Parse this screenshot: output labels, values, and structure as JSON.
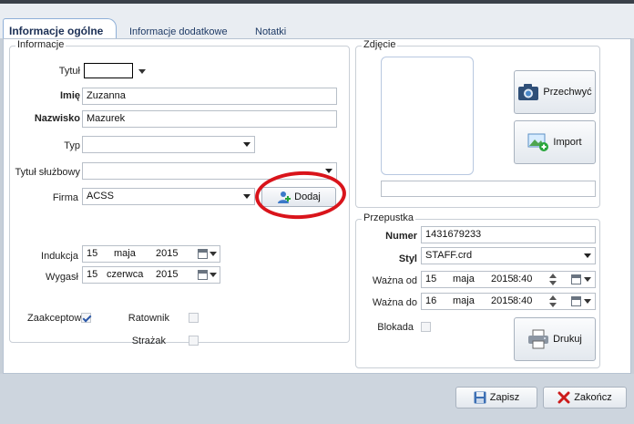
{
  "tabs": [
    "Informacje ogólne",
    "Informacje dodatkowe",
    "Notatki"
  ],
  "info": {
    "title": "Informacje",
    "fields": {
      "tytul_label": "Tytuł",
      "tytul_value": "",
      "imie_label": "Imię",
      "imie_value": "Zuzanna",
      "nazwisko_label": "Nazwisko",
      "nazwisko_value": "Mazurek",
      "typ_label": "Typ",
      "typ_value": "",
      "tytul_sluzbowy_label": "Tytuł służbowy",
      "tytul_sluzbowy_value": "",
      "firma_label": "Firma",
      "firma_value": "ACSS",
      "dodaj_label": "Dodaj"
    },
    "indukcja": {
      "label": "Indukcja",
      "day": "15",
      "month": "maja",
      "year": "2015"
    },
    "wygasl": {
      "label": "Wygasł",
      "day": "15",
      "month": "czerwca",
      "year": "2015"
    },
    "checks": {
      "zaakceptow": {
        "label": "Zaakceptow",
        "checked": true
      },
      "ratownik": {
        "label": "Ratownik",
        "checked": false
      },
      "strazak": {
        "label": "Strażak",
        "checked": false
      }
    }
  },
  "photo": {
    "title": "Zdjęcie",
    "capture_label": "Przechwyć",
    "import_label": "Import",
    "caption": ""
  },
  "pass": {
    "title": "Przepustka",
    "numer_label": "Numer",
    "numer_value": "1431679233",
    "styl_label": "Styl",
    "styl_value": "STAFF.crd",
    "wazna_od": {
      "label": "Ważna od",
      "day": "15",
      "month": "maja",
      "year_time": "2015",
      "time": "8:40"
    },
    "wazna_do": {
      "label": "Ważna do",
      "day": "16",
      "month": "maja",
      "year_time": "2015",
      "time": "8:40"
    },
    "blokada_label": "Blokada",
    "blokada_checked": false,
    "drukuj_label": "Drukuj"
  },
  "footer": {
    "save_label": "Zapisz",
    "close_label": "Zakończ"
  },
  "colors": {
    "accent": "#1f3b66",
    "annotation": "#d9141b",
    "close_x": "#cc1b1b"
  }
}
